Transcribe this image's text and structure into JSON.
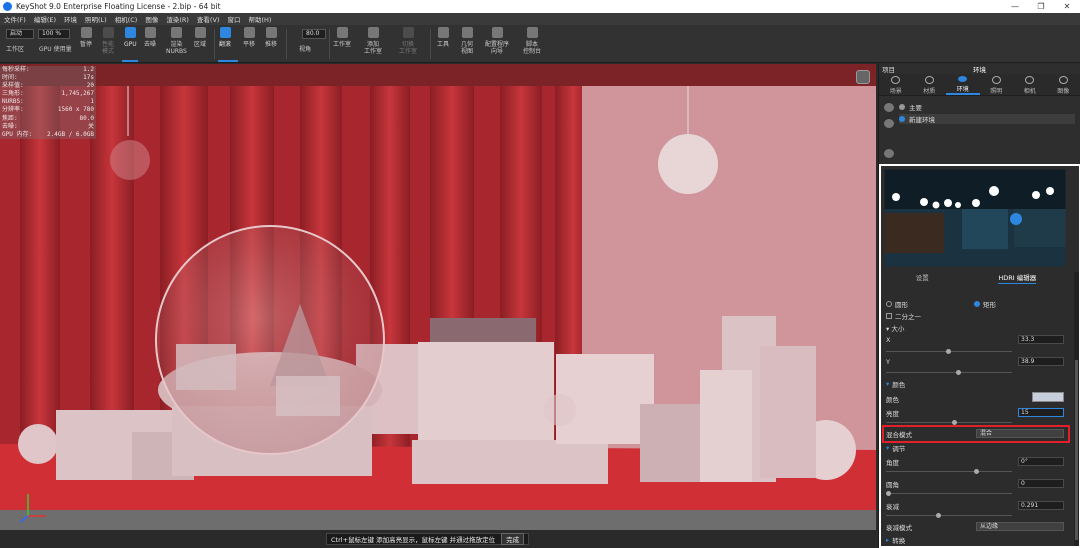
{
  "window": {
    "title": "KeyShot 9.0 Enterprise Floating License  - 2.bip  - 64 bit",
    "controls": [
      "—",
      "❐",
      "✕"
    ]
  },
  "menu": [
    "文件(F)",
    "编辑(E)",
    "环境",
    "照明(L)",
    "相机(C)",
    "图像",
    "渲染(R)",
    "查看(V)",
    "窗口",
    "帮助(H)"
  ],
  "toolbar": {
    "mode_value": "启动",
    "zoom_value": "100 %",
    "items": [
      {
        "label": "工作区"
      },
      {
        "label": "GPU 使用量"
      },
      {
        "label": "暂停"
      },
      {
        "label": "性能\n模式"
      },
      {
        "label": "GPU"
      },
      {
        "label": "去噪"
      },
      {
        "label": "渲染\nNURBS"
      },
      {
        "label": "区域"
      },
      {
        "label": "翻滚"
      },
      {
        "label": "平移"
      },
      {
        "label": "推移"
      },
      {
        "label": "视角"
      },
      {
        "label": "工作室"
      },
      {
        "label": "添加\n工作室"
      },
      {
        "label": "切换\n工作室"
      },
      {
        "label": "工具"
      },
      {
        "label": "几何\n视图"
      },
      {
        "label": "配置程序\n向导"
      },
      {
        "label": "脚本\n控制台"
      }
    ],
    "fov_value": "80.0"
  },
  "stats": [
    {
      "k": "每秒采样:",
      "v": "1.2"
    },
    {
      "k": "时间:",
      "v": "17s"
    },
    {
      "k": "采样值:",
      "v": "20"
    },
    {
      "k": "三角形:",
      "v": "1,745,267"
    },
    {
      "k": "NURBS:",
      "v": "1"
    },
    {
      "k": "分辨率:",
      "v": "1560 x 780"
    },
    {
      "k": "焦距:",
      "v": "80.0"
    },
    {
      "k": "去噪:",
      "v": "关"
    },
    {
      "k": "GPU 内存:",
      "v": "2.4GB / 6.0GB"
    }
  ],
  "status_hint": "Ctrl+鼠标左键 添加高亮显示，鼠标左键 并通过拖放定位",
  "status_done": "完成",
  "panel": {
    "head_left": "项目",
    "head_center": "环境",
    "tabs": [
      {
        "label": "场景",
        "active": false
      },
      {
        "label": "材质",
        "active": false
      },
      {
        "label": "环境",
        "active": true
      },
      {
        "label": "照明",
        "active": false
      },
      {
        "label": "相机",
        "active": false
      },
      {
        "label": "图像",
        "active": false
      }
    ],
    "env_items": [
      "主要",
      "新建环境"
    ],
    "subtabs": [
      "设置",
      "HDRI 编辑器"
    ],
    "shape_options": [
      "圆形",
      "矩形"
    ],
    "half_label": "二分之一",
    "size_label": "▾ 大小",
    "x_label": "X",
    "x_value": "33.3",
    "y_label": "Y",
    "y_value": "38.9",
    "color_section": "颜色",
    "color_label": "颜色",
    "color_swatch": "#c8cfdc",
    "brightness_label": "亮度",
    "brightness_value": "15",
    "blend_label": "混合模式",
    "blend_value": "混合",
    "adjust_section": "调节",
    "angle_label": "角度",
    "angle_value": "0°",
    "round_label": "圆角",
    "round_value": "0",
    "falloff_label": "衰减",
    "falloff_value": "0.291",
    "falloff_mode_label": "衰减模式",
    "falloff_mode_value": "从边缘",
    "transform_section": "转换"
  },
  "colors": {
    "accent": "#2e86de",
    "highlight_border": "#e2202b"
  }
}
